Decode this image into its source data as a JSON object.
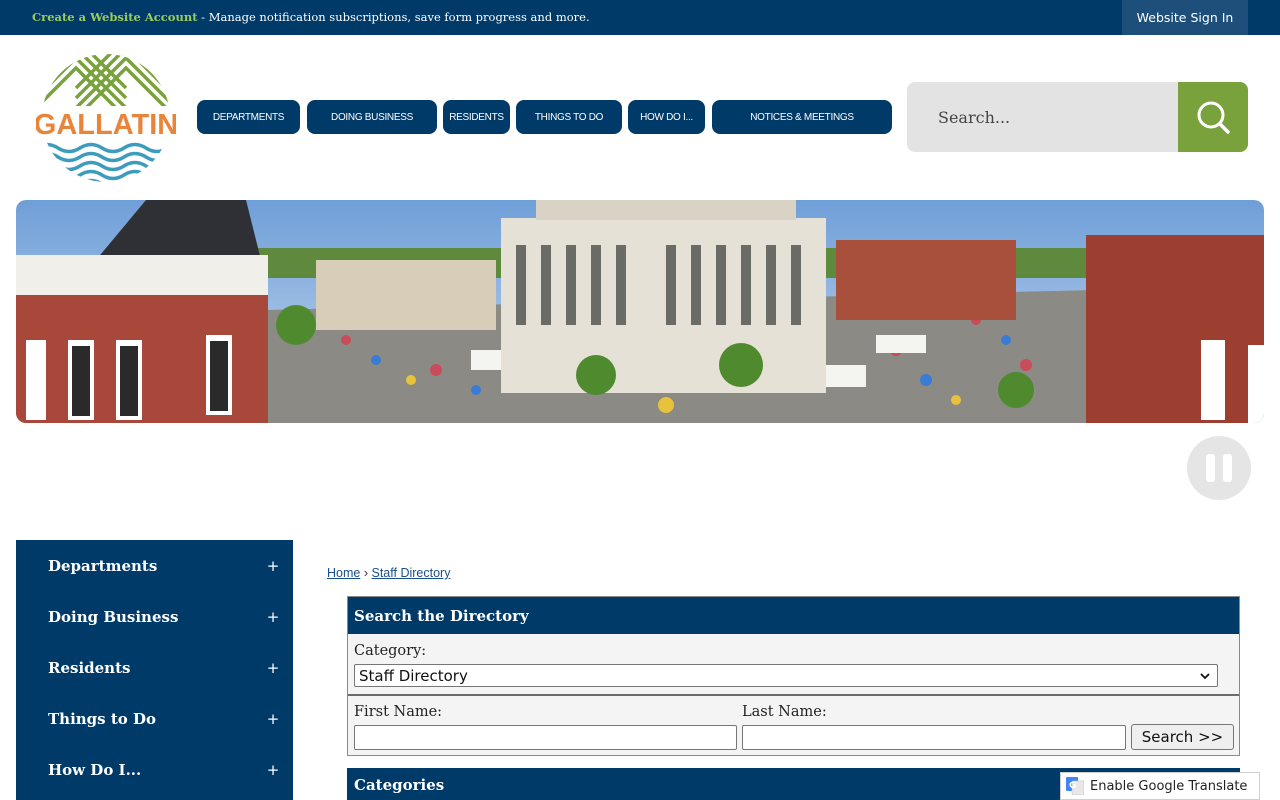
{
  "topbar": {
    "account_link": "Create a Website Account",
    "account_desc": " - Manage notification subscriptions, save form progress and more.",
    "sign_in": "Website Sign In"
  },
  "logo": {
    "text": "GALLATIN"
  },
  "nav": [
    {
      "label": "DEPARTMENTS"
    },
    {
      "label": "DOING BUSINESS"
    },
    {
      "label": "RESIDENTS"
    },
    {
      "label": "THINGS TO DO"
    },
    {
      "label": "HOW DO I..."
    },
    {
      "label": "NOTICES & MEETINGS"
    }
  ],
  "search": {
    "placeholder": "Search..."
  },
  "sidebar": {
    "items": [
      {
        "label": "Departments",
        "toggle": "+"
      },
      {
        "label": "Doing Business",
        "toggle": "+"
      },
      {
        "label": "Residents",
        "toggle": "+"
      },
      {
        "label": "Things to Do",
        "toggle": "+"
      },
      {
        "label": "How Do I...",
        "toggle": "+"
      }
    ]
  },
  "breadcrumb": {
    "home": "Home",
    "sep": "›",
    "current": "Staff Directory"
  },
  "directory": {
    "header": "Search the Directory",
    "category_label": "Category:",
    "category_value": "Staff Directory",
    "first_name_label": "First Name:",
    "last_name_label": "Last Name:",
    "search_button": "Search >>"
  },
  "categories": {
    "header": "Categories"
  },
  "translate": {
    "label": "Enable Google Translate"
  },
  "colors": {
    "navy": "#003a68",
    "green": "#7aa23c",
    "accent_green": "#9ccc5a"
  }
}
